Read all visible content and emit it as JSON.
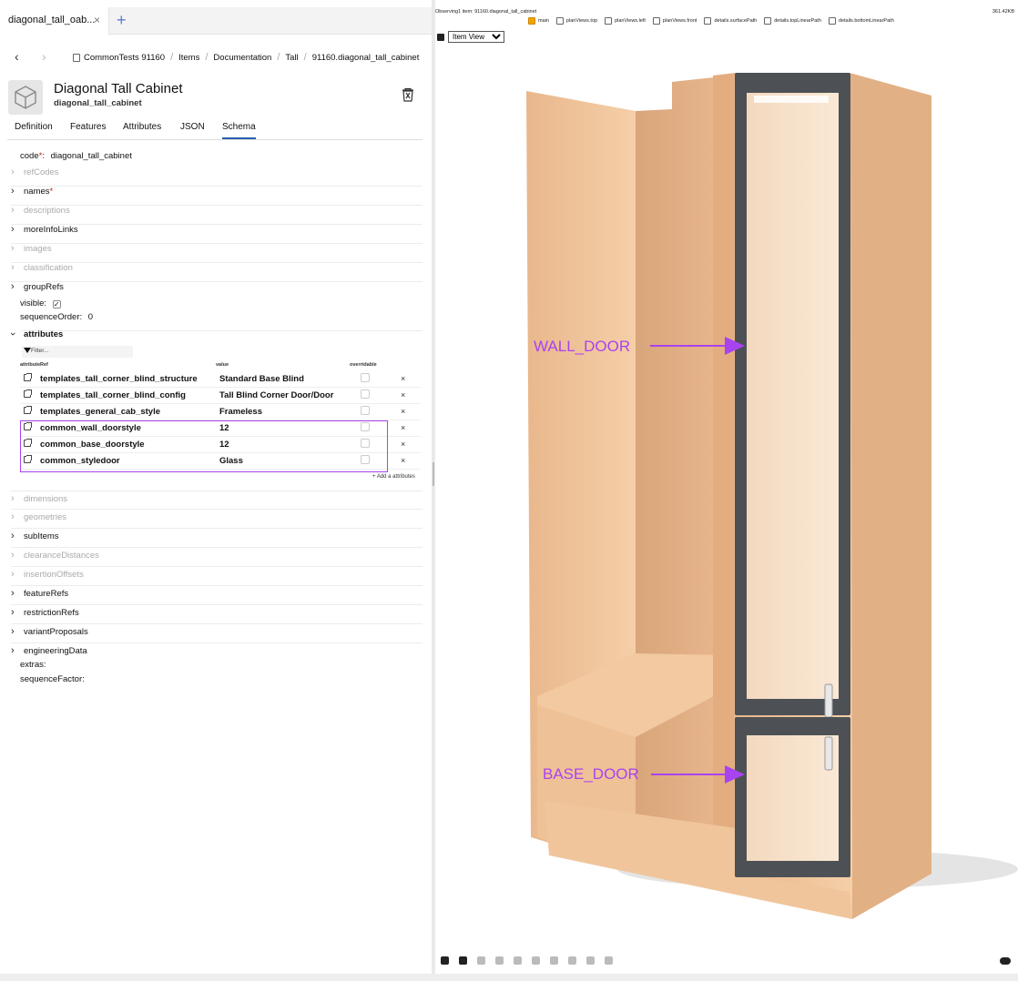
{
  "tab": {
    "title": "diagonal_tall_oab...",
    "close": "×",
    "new": "+"
  },
  "breadcrumb": {
    "back": "‹",
    "forward": "›",
    "items": [
      "CommonTests 91160",
      "Items",
      "Documentation",
      "Tall",
      "91160.diagonal_tall_cabinet"
    ],
    "separator": "/"
  },
  "item": {
    "title": "Diagonal Tall Cabinet",
    "subtitle": "diagonal_tall_cabinet"
  },
  "tabs": [
    "Definition",
    "Features",
    "Attributes",
    "JSON",
    "Schema"
  ],
  "active_tab": "Schema",
  "schema": {
    "code_label": "code",
    "code_value": "diagonal_tall_cabinet",
    "required_mark": "*",
    "rows_top": [
      {
        "label": "refCodes",
        "enabled": false
      },
      {
        "label": "names",
        "enabled": true,
        "required": true
      },
      {
        "label": "descriptions",
        "enabled": false
      },
      {
        "label": "moreInfoLinks",
        "enabled": true
      },
      {
        "label": "images",
        "enabled": false
      },
      {
        "label": "classification",
        "enabled": false
      },
      {
        "label": "groupRefs",
        "enabled": true
      }
    ],
    "visible_label": "visible:",
    "visible_checked": true,
    "sequence_order_label": "sequenceOrder:",
    "sequence_order_value": "0",
    "attributes_label": "attributes",
    "filter_placeholder": "Filter...",
    "columns": {
      "ref": "attributeRef",
      "value": "value",
      "overridable": "overridable"
    },
    "attributes": [
      {
        "ref": "templates_tall_corner_blind_structure",
        "value": "Standard Base Blind"
      },
      {
        "ref": "templates_tall_corner_blind_config",
        "value": "Tall Blind Corner Door/Door"
      },
      {
        "ref": "templates_general_cab_style",
        "value": "Frameless"
      },
      {
        "ref": "common_wall_doorstyle",
        "value": "12"
      },
      {
        "ref": "common_base_doorstyle",
        "value": "12"
      },
      {
        "ref": "common_styledoor",
        "value": "Glass"
      }
    ],
    "remove_symbol": "×",
    "add_attributes": "+ Add a attributes",
    "rows_bottom": [
      {
        "label": "dimensions",
        "enabled": false
      },
      {
        "label": "geometries",
        "enabled": false
      },
      {
        "label": "subItems",
        "enabled": true
      },
      {
        "label": "clearanceDistances",
        "enabled": false
      },
      {
        "label": "insertionOffsets",
        "enabled": false
      },
      {
        "label": "featureRefs",
        "enabled": true
      },
      {
        "label": "restrictionRefs",
        "enabled": true
      },
      {
        "label": "variantProposals",
        "enabled": true
      },
      {
        "label": "engineeringData",
        "enabled": true
      }
    ],
    "extras_label": "extras:",
    "sequence_factor_label": "sequenceFactor:"
  },
  "viewer": {
    "observing": "Observing1 item: 91160.diagonal_tall_cabinet",
    "size": "361.42KB",
    "layers": [
      {
        "label": "main",
        "checked": true
      },
      {
        "label": "planViews.top",
        "checked": false
      },
      {
        "label": "planViews.left",
        "checked": false
      },
      {
        "label": "planViews.front",
        "checked": false
      },
      {
        "label": "details.surfacePath",
        "checked": false
      },
      {
        "label": "details.topLinearPath",
        "checked": false
      },
      {
        "label": "details.bottomLinearPath",
        "checked": false
      }
    ],
    "view_mode": "Item View",
    "annotations": {
      "wall_door": "WALL_DOOR",
      "base_door": "BASE_DOOR"
    },
    "annotation_color": "#a943f0"
  },
  "colors": {
    "wood": "#efc39a",
    "frame": "#4d5156",
    "accent": "#2a5db0",
    "highlight": "#a943f0"
  }
}
